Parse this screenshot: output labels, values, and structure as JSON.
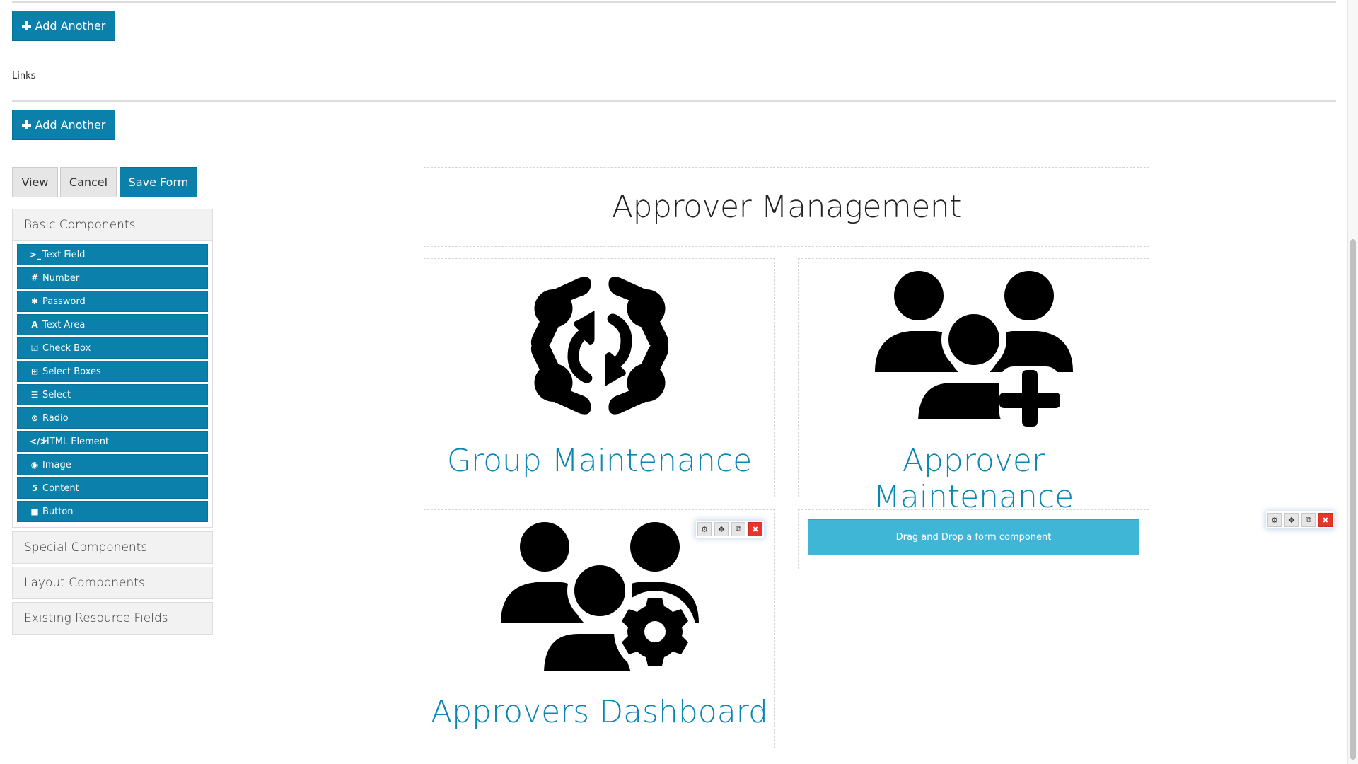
{
  "top_section": {
    "add_another_1": "Add Another",
    "links_label": "Links",
    "add_another_2": "Add Another"
  },
  "actions": {
    "view": "View",
    "cancel": "Cancel",
    "save": "Save Form"
  },
  "sidebar": {
    "groups": [
      {
        "label": "Basic Components",
        "expanded": true,
        "items": [
          {
            "label": "Text Field",
            "icon": "terminal-icon",
            "glyph": ">_"
          },
          {
            "label": "Number",
            "icon": "hashtag-icon",
            "glyph": "#"
          },
          {
            "label": "Password",
            "icon": "asterisk-icon",
            "glyph": "✱"
          },
          {
            "label": "Text Area",
            "icon": "font-icon",
            "glyph": "A"
          },
          {
            "label": "Check Box",
            "icon": "check-square-icon",
            "glyph": "☑"
          },
          {
            "label": "Select Boxes",
            "icon": "plus-square-icon",
            "glyph": "⊞"
          },
          {
            "label": "Select",
            "icon": "list-icon",
            "glyph": "☰"
          },
          {
            "label": "Radio",
            "icon": "dot-circle-icon",
            "glyph": "⊙"
          },
          {
            "label": "HTML Element",
            "icon": "code-icon",
            "glyph": "</>"
          },
          {
            "label": "Image",
            "icon": "camera-icon",
            "glyph": "◉"
          },
          {
            "label": "Content",
            "icon": "html5-icon",
            "glyph": "5"
          },
          {
            "label": "Button",
            "icon": "stop-icon",
            "glyph": "■"
          }
        ]
      },
      {
        "label": "Special Components",
        "expanded": false
      },
      {
        "label": "Layout Components",
        "expanded": false
      },
      {
        "label": "Existing Resource Fields",
        "expanded": false
      }
    ]
  },
  "canvas": {
    "title": "Approver Management",
    "cards": [
      {
        "title": "Group Maintenance",
        "icon": "group-sync-icon"
      },
      {
        "title": "Approver Maintenance",
        "icon": "users-plus-icon"
      },
      {
        "title": "Approvers Dashboard",
        "icon": "users-gear-icon"
      }
    ],
    "dropzone_text": "Drag and Drop a form component"
  },
  "toolbar": {
    "edit_glyph": "⚙",
    "move_glyph": "✥",
    "copy_glyph": "⧉",
    "remove_glyph": "✖"
  },
  "colors": {
    "primary": "#0a80ab",
    "link": "#0a86b4",
    "dropzone": "#40b6d7",
    "danger": "#e8352b"
  }
}
